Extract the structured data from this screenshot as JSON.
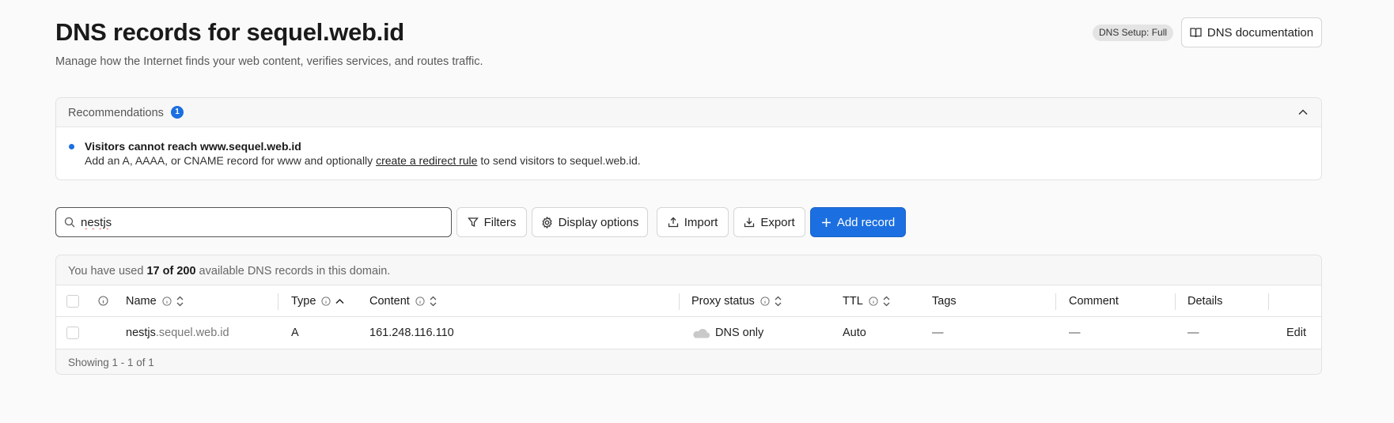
{
  "header": {
    "title": "DNS records for sequel.web.id",
    "subtitle": "Manage how the Internet finds your web content, verifies services, and routes traffic.",
    "setup_badge": "DNS Setup: Full",
    "doc_button": "DNS documentation"
  },
  "recommendations": {
    "title": "Recommendations",
    "count": "1",
    "item_title": "Visitors cannot reach www.sequel.web.id",
    "item_body_pre": "Add an A, AAAA, or CNAME record for www and optionally ",
    "item_body_link": "create a redirect rule",
    "item_body_post": " to send visitors to sequel.web.id."
  },
  "toolbar": {
    "search_value": "nestjs",
    "filters": "Filters",
    "display_options": "Display options",
    "import": "Import",
    "export": "Export",
    "add_record": "Add record"
  },
  "usage": {
    "pre": "You have used ",
    "count": "17 of 200",
    "post": " available DNS records in this domain."
  },
  "table": {
    "columns": {
      "name": "Name",
      "type": "Type",
      "content": "Content",
      "proxy_status": "Proxy status",
      "ttl": "TTL",
      "tags": "Tags",
      "comment": "Comment",
      "details": "Details"
    },
    "rows": [
      {
        "name_prefix": "nestjs",
        "name_suffix": ".sequel.web.id",
        "type": "A",
        "content": "161.248.116.110",
        "proxy_status": "DNS only",
        "ttl": "Auto",
        "tags": "—",
        "comment": "—",
        "details": "—",
        "edit": "Edit"
      }
    ],
    "showing": "Showing 1 - 1 of 1"
  },
  "colors": {
    "accent": "#1b6fe0",
    "background": "#fafafa"
  }
}
